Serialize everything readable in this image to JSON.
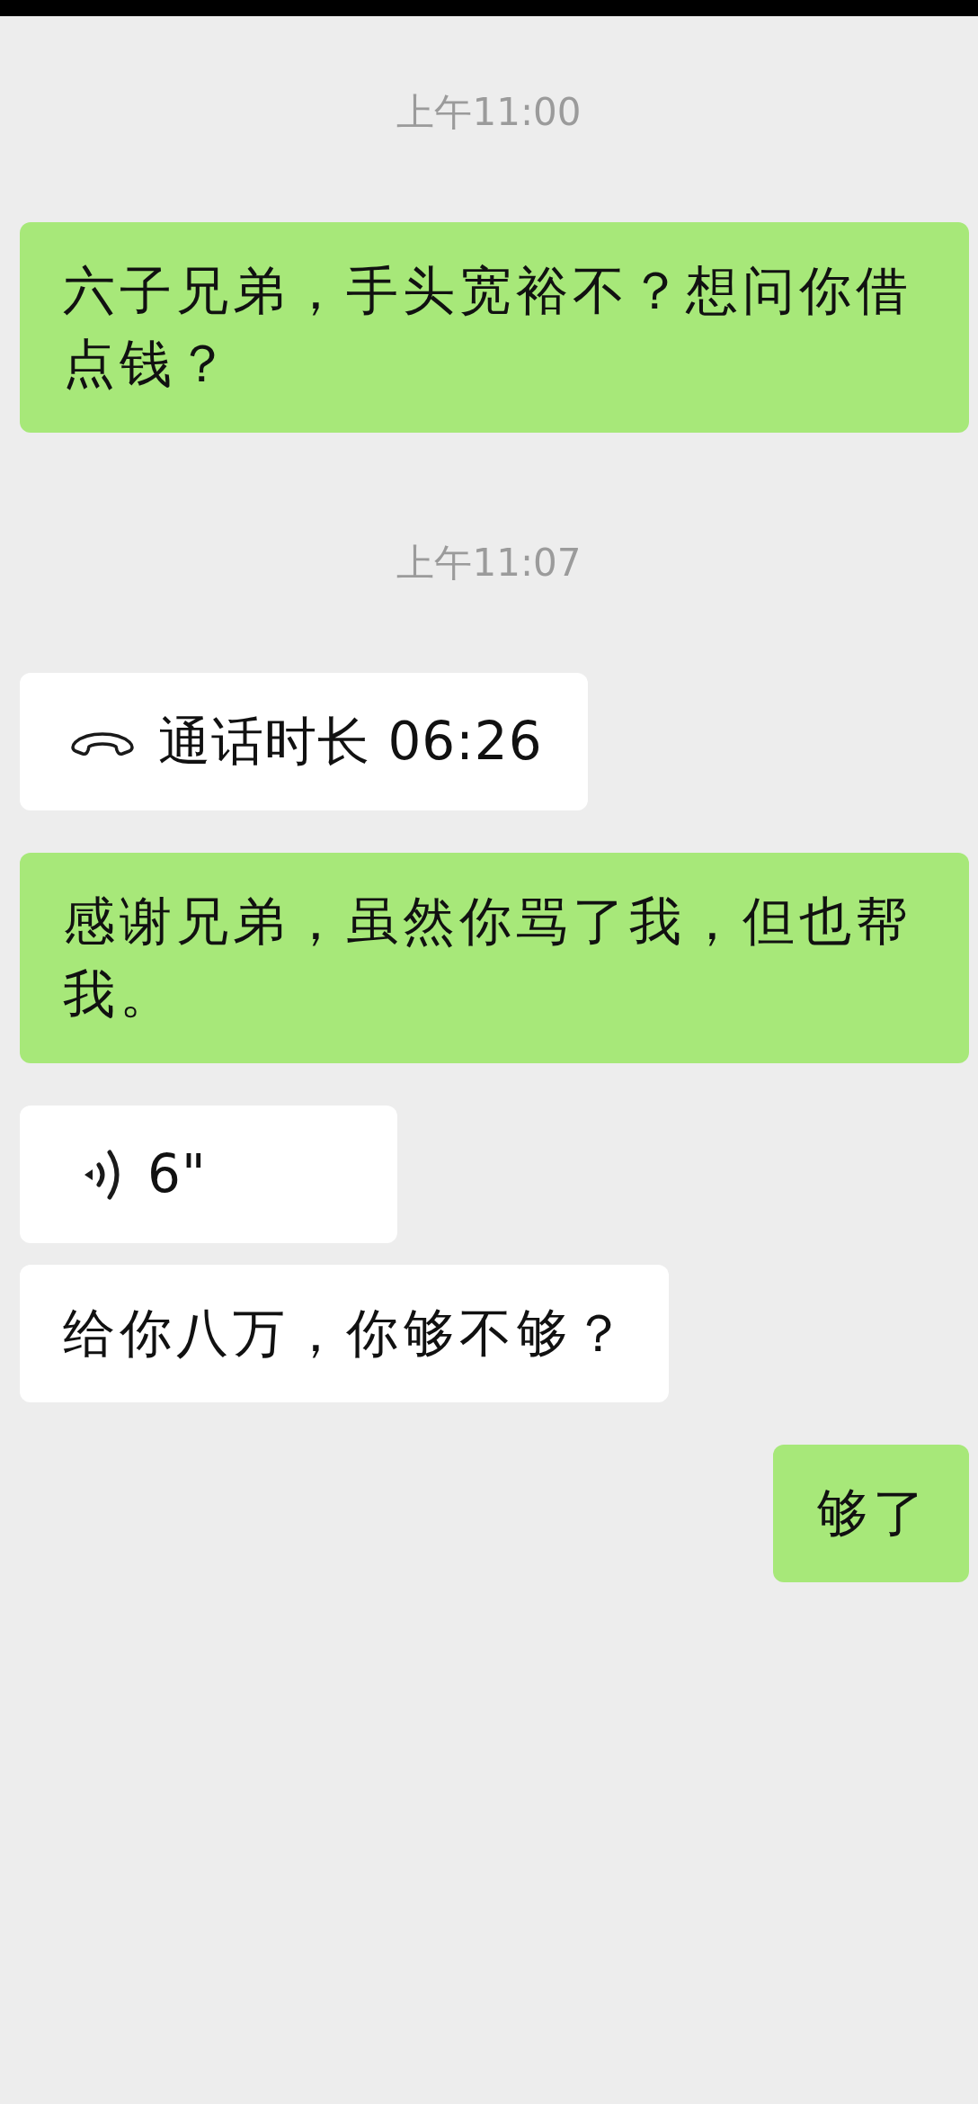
{
  "messages": [
    {
      "kind": "time",
      "text": "上午11:00"
    },
    {
      "kind": "text",
      "outgoing": true,
      "text": "六子兄弟，手头宽裕不？想问你借点钱？"
    },
    {
      "kind": "time",
      "text": "上午11:07"
    },
    {
      "kind": "call",
      "outgoing": false,
      "text": "通话时长 06:26"
    },
    {
      "kind": "text",
      "outgoing": true,
      "text": "感谢兄弟，虽然你骂了我，但也帮我。"
    },
    {
      "kind": "voice",
      "outgoing": false,
      "text": "6\""
    },
    {
      "kind": "text",
      "outgoing": false,
      "text": "给你八万，你够不够？"
    },
    {
      "kind": "text",
      "outgoing": true,
      "text": "够了"
    }
  ]
}
